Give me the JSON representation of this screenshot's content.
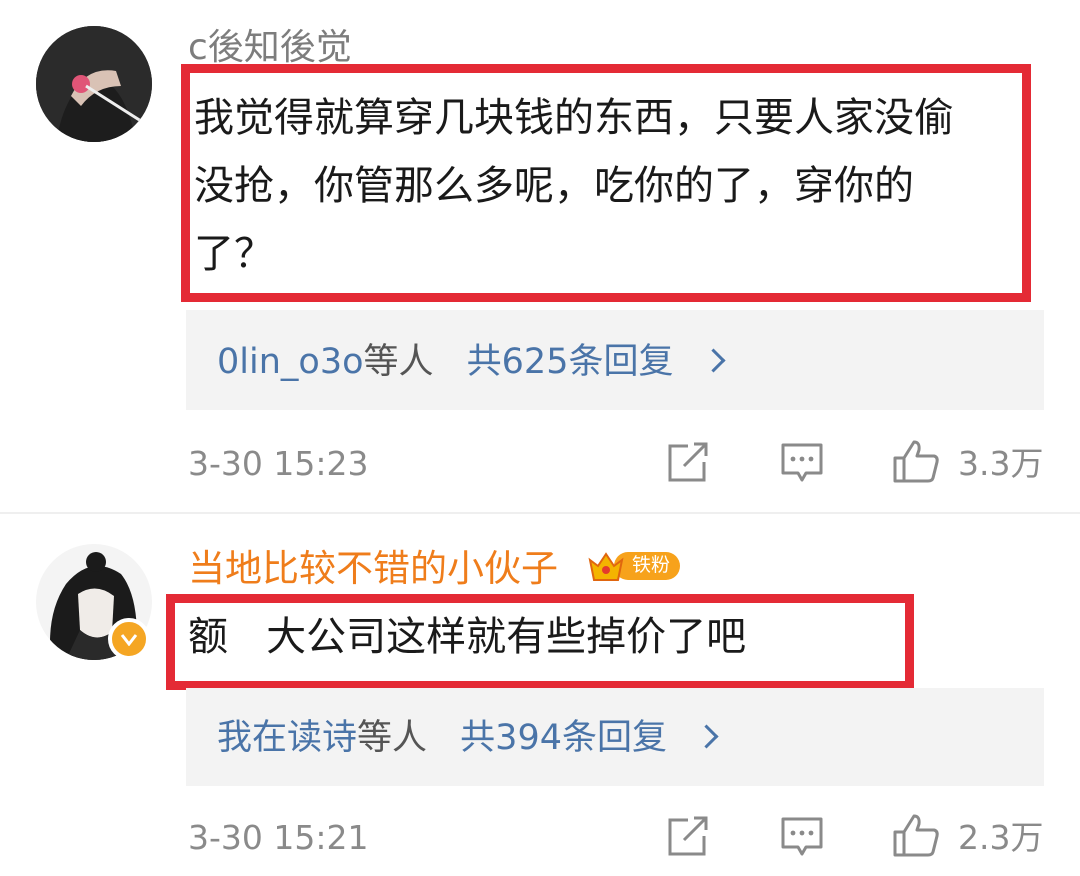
{
  "comments": [
    {
      "username": "c後知後觉",
      "text_lines": [
        "我觉得就算穿几块钱的东西，只要人家没偷",
        "没抢，你管那么多呢，吃你的了，穿你的",
        "了？"
      ],
      "replies": {
        "users": "0lin_o3o",
        "suffix": "等人",
        "count_text": "共625条回复"
      },
      "time": "3-30 15:23",
      "likes": "3.3万"
    },
    {
      "username": "当地比较不错的小伙子",
      "fan_badge": "铁粉",
      "text_lines": [
        "额   大公司这样就有些掉价了吧"
      ],
      "replies": {
        "users": "我在读诗",
        "suffix": "等人",
        "count_text": "共394条回复"
      },
      "time": "3-30 15:21",
      "likes": "2.3万"
    }
  ],
  "colors": {
    "highlight_box": "#e42a35",
    "username_vip": "#ef7d1b",
    "link": "#4a74a8"
  }
}
